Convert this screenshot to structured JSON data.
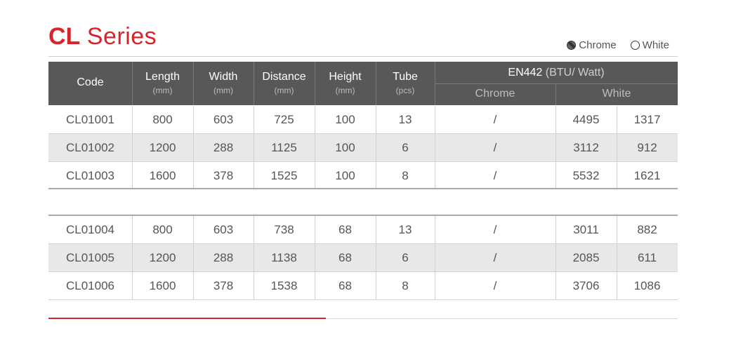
{
  "title": {
    "bold": "CL",
    "rest": "Series"
  },
  "finish_options": [
    {
      "label": "Chrome",
      "icon": "filled-circle-icon"
    },
    {
      "label": "White",
      "icon": "empty-circle-icon"
    }
  ],
  "header": {
    "code": "Code",
    "length": "Length",
    "length_unit": "(mm)",
    "width": "Width",
    "width_unit": "(mm)",
    "distance": "Distance",
    "distance_unit": "(mm)",
    "height": "Height",
    "height_unit": "(mm)",
    "tube": "Tube",
    "tube_unit": "(pcs)",
    "en442_bold": "EN442",
    "en442_rest": "(BTU/ Watt)",
    "chrome": "Chrome",
    "white": "White"
  },
  "rows": [
    {
      "code": "CL01001",
      "length": "800",
      "width": "603",
      "distance": "725",
      "height": "100",
      "tube": "13",
      "chrome": "/",
      "white_btu": "4495",
      "white_watt": "1317"
    },
    {
      "code": "CL01002",
      "length": "1200",
      "width": "288",
      "distance": "1125",
      "height": "100",
      "tube": "6",
      "chrome": "/",
      "white_btu": "3112",
      "white_watt": "912"
    },
    {
      "code": "CL01003",
      "length": "1600",
      "width": "378",
      "distance": "1525",
      "height": "100",
      "tube": "8",
      "chrome": "/",
      "white_btu": "5532",
      "white_watt": "1621"
    },
    {
      "code": "CL01004",
      "length": "800",
      "width": "603",
      "distance": "738",
      "height": "68",
      "tube": "13",
      "chrome": "/",
      "white_btu": "3011",
      "white_watt": "882"
    },
    {
      "code": "CL01005",
      "length": "1200",
      "width": "288",
      "distance": "1138",
      "height": "68",
      "tube": "6",
      "chrome": "/",
      "white_btu": "2085",
      "white_watt": "611"
    },
    {
      "code": "CL01006",
      "length": "1600",
      "width": "378",
      "distance": "1538",
      "height": "68",
      "tube": "8",
      "chrome": "/",
      "white_btu": "3706",
      "white_watt": "1086"
    }
  ],
  "colors": {
    "accent": "#d8232a",
    "header_bg": "#595757",
    "row_alt": "#e8e8e8"
  }
}
